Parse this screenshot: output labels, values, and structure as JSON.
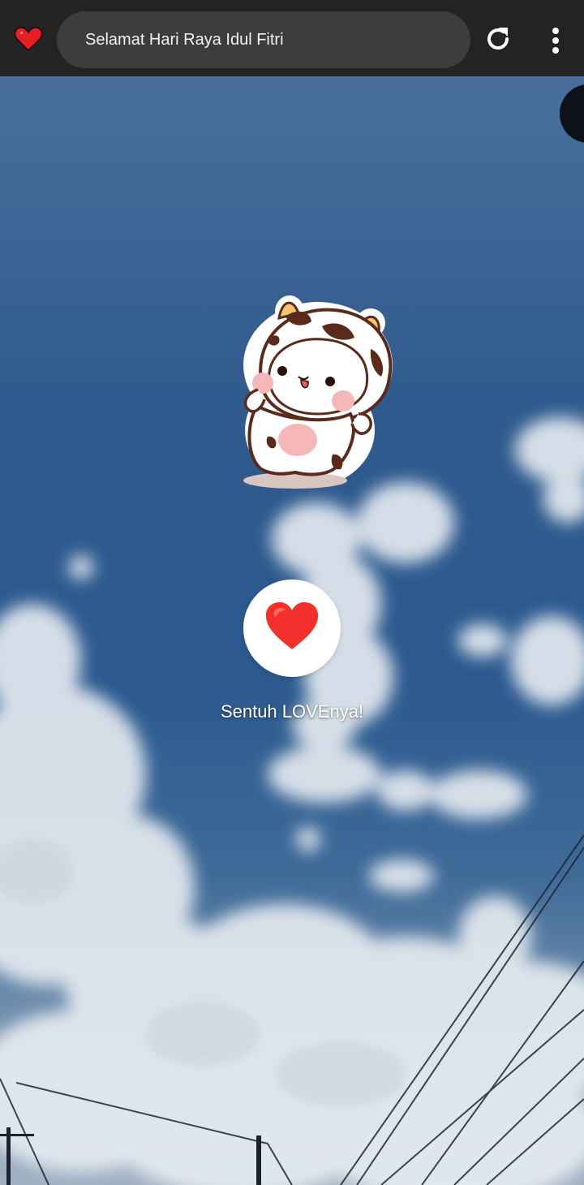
{
  "browser": {
    "favicon": "heart-icon",
    "url_text": "Selamat Hari Raya Idul Fitri",
    "reload_icon": "reload-icon",
    "menu_icon": "more-vertical-icon"
  },
  "page": {
    "sticker": "cow-costume-bear-sticker",
    "button_icon": "red-heart-icon",
    "touch_label": "Sentuh LOVEnya!"
  },
  "colors": {
    "topbar": "#232323",
    "url_pill": "#3d3d3d",
    "sky_blue": "#2f5a8d",
    "heart_red": "#f3302c"
  }
}
